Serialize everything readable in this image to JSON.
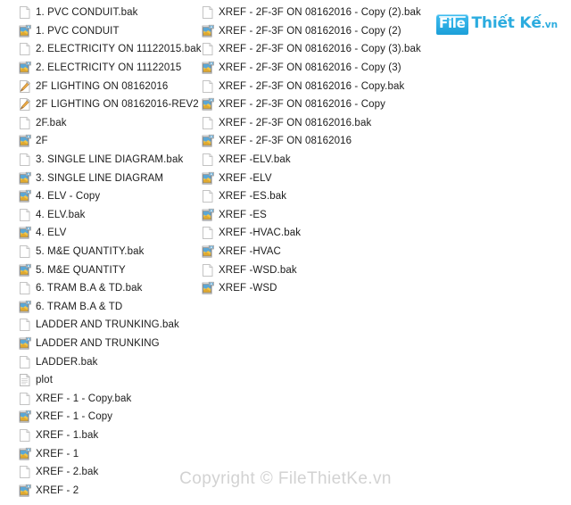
{
  "logo": {
    "badge_text": "File",
    "main_text": "Thiết Kế",
    "tld_text": ".vn",
    "accent_color": "#2cacdf"
  },
  "watermark": {
    "text": "Copyright © FileThietKe.vn",
    "color": "#d2d2d2"
  },
  "icons": {
    "bak": "blank-document-icon",
    "dwg": "autocad-dwg-icon",
    "dws": "autocad-dws-icon",
    "text": "text-document-icon"
  },
  "columns": {
    "left": [
      {
        "name": "1. PVC CONDUIT.bak",
        "icon": "bak"
      },
      {
        "name": "1. PVC CONDUIT",
        "icon": "dwg"
      },
      {
        "name": "2. ELECTRICITY ON 11122015.bak",
        "icon": "bak"
      },
      {
        "name": "2. ELECTRICITY ON 11122015",
        "icon": "dwg"
      },
      {
        "name": "2F LIGHTING ON 08162016",
        "icon": "dws"
      },
      {
        "name": "2F LIGHTING ON 08162016-REV2",
        "icon": "dws"
      },
      {
        "name": "2F.bak",
        "icon": "bak"
      },
      {
        "name": "2F",
        "icon": "dwg"
      },
      {
        "name": "3. SINGLE LINE DIAGRAM.bak",
        "icon": "bak"
      },
      {
        "name": "3. SINGLE LINE DIAGRAM",
        "icon": "dwg"
      },
      {
        "name": "4. ELV - Copy",
        "icon": "dwg"
      },
      {
        "name": "4. ELV.bak",
        "icon": "bak"
      },
      {
        "name": "4. ELV",
        "icon": "dwg"
      },
      {
        "name": "5. M&E QUANTITY.bak",
        "icon": "bak"
      },
      {
        "name": "5. M&E QUANTITY",
        "icon": "dwg"
      },
      {
        "name": "6. TRAM B.A & TD.bak",
        "icon": "bak"
      },
      {
        "name": "6. TRAM B.A & TD",
        "icon": "dwg"
      },
      {
        "name": "LADDER AND TRUNKING.bak",
        "icon": "bak"
      },
      {
        "name": "LADDER AND TRUNKING",
        "icon": "dwg"
      },
      {
        "name": "LADDER.bak",
        "icon": "bak"
      },
      {
        "name": "plot",
        "icon": "text"
      },
      {
        "name": "XREF - 1 - Copy.bak",
        "icon": "bak"
      },
      {
        "name": "XREF - 1 - Copy",
        "icon": "dwg"
      },
      {
        "name": "XREF - 1.bak",
        "icon": "bak"
      },
      {
        "name": "XREF - 1",
        "icon": "dwg"
      },
      {
        "name": "XREF - 2.bak",
        "icon": "bak"
      },
      {
        "name": "XREF - 2",
        "icon": "dwg"
      }
    ],
    "right": [
      {
        "name": "XREF - 2F-3F ON 08162016 - Copy (2).bak",
        "icon": "bak"
      },
      {
        "name": "XREF - 2F-3F ON 08162016 - Copy (2)",
        "icon": "dwg"
      },
      {
        "name": "XREF - 2F-3F ON 08162016 - Copy (3).bak",
        "icon": "bak"
      },
      {
        "name": "XREF - 2F-3F ON 08162016 - Copy (3)",
        "icon": "dwg"
      },
      {
        "name": "XREF - 2F-3F ON 08162016 - Copy.bak",
        "icon": "bak"
      },
      {
        "name": "XREF - 2F-3F ON 08162016 - Copy",
        "icon": "dwg"
      },
      {
        "name": "XREF - 2F-3F ON 08162016.bak",
        "icon": "bak"
      },
      {
        "name": "XREF - 2F-3F ON 08162016",
        "icon": "dwg"
      },
      {
        "name": "XREF -ELV.bak",
        "icon": "bak"
      },
      {
        "name": "XREF -ELV",
        "icon": "dwg"
      },
      {
        "name": "XREF -ES.bak",
        "icon": "bak"
      },
      {
        "name": "XREF -ES",
        "icon": "dwg"
      },
      {
        "name": "XREF -HVAC.bak",
        "icon": "bak"
      },
      {
        "name": "XREF -HVAC",
        "icon": "dwg"
      },
      {
        "name": "XREF -WSD.bak",
        "icon": "bak"
      },
      {
        "name": "XREF -WSD",
        "icon": "dwg"
      }
    ]
  }
}
